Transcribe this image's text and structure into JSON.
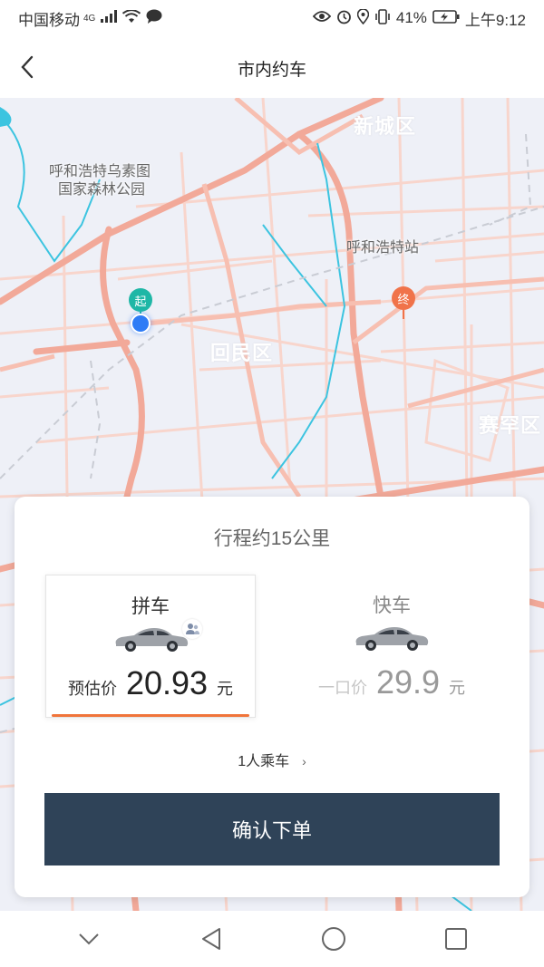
{
  "status_bar": {
    "carrier": "中国移动",
    "network": "4G",
    "battery": "41%",
    "time": "上午9:12"
  },
  "nav": {
    "title": "市内约车",
    "back_icon": "chevron-left-icon"
  },
  "map": {
    "labels": {
      "forest_park_line1": "呼和浩特乌素图",
      "forest_park_line2": "国家森林公园",
      "station": "呼和浩特站",
      "district_xincheng": "新城区",
      "district_huimin": "回民区",
      "district_saihan": "赛罕区"
    },
    "start_marker": "起",
    "end_marker": "终",
    "colors": {
      "road": "#f6c4b8",
      "main_road": "#f2a999",
      "water": "#3cc4e0",
      "rail": "#c9ccd4",
      "start": "#1fb7a6",
      "end": "#f0734a"
    }
  },
  "card": {
    "trip_distance": "行程约15公里",
    "options": [
      {
        "name": "拼车",
        "price_prefix": "预估价",
        "price": "20.93",
        "unit": "元",
        "selected": true
      },
      {
        "name": "快车",
        "price_prefix": "一口价",
        "price": "29.9",
        "unit": "元",
        "selected": false
      }
    ],
    "passengers": "1人乘车",
    "confirm_label": "确认下单",
    "accent_color": "#f0743a",
    "button_color": "#2f4358"
  },
  "system_nav": {
    "icons": [
      "chevron-down-icon",
      "back-triangle-icon",
      "home-circle-icon",
      "recents-square-icon"
    ]
  }
}
